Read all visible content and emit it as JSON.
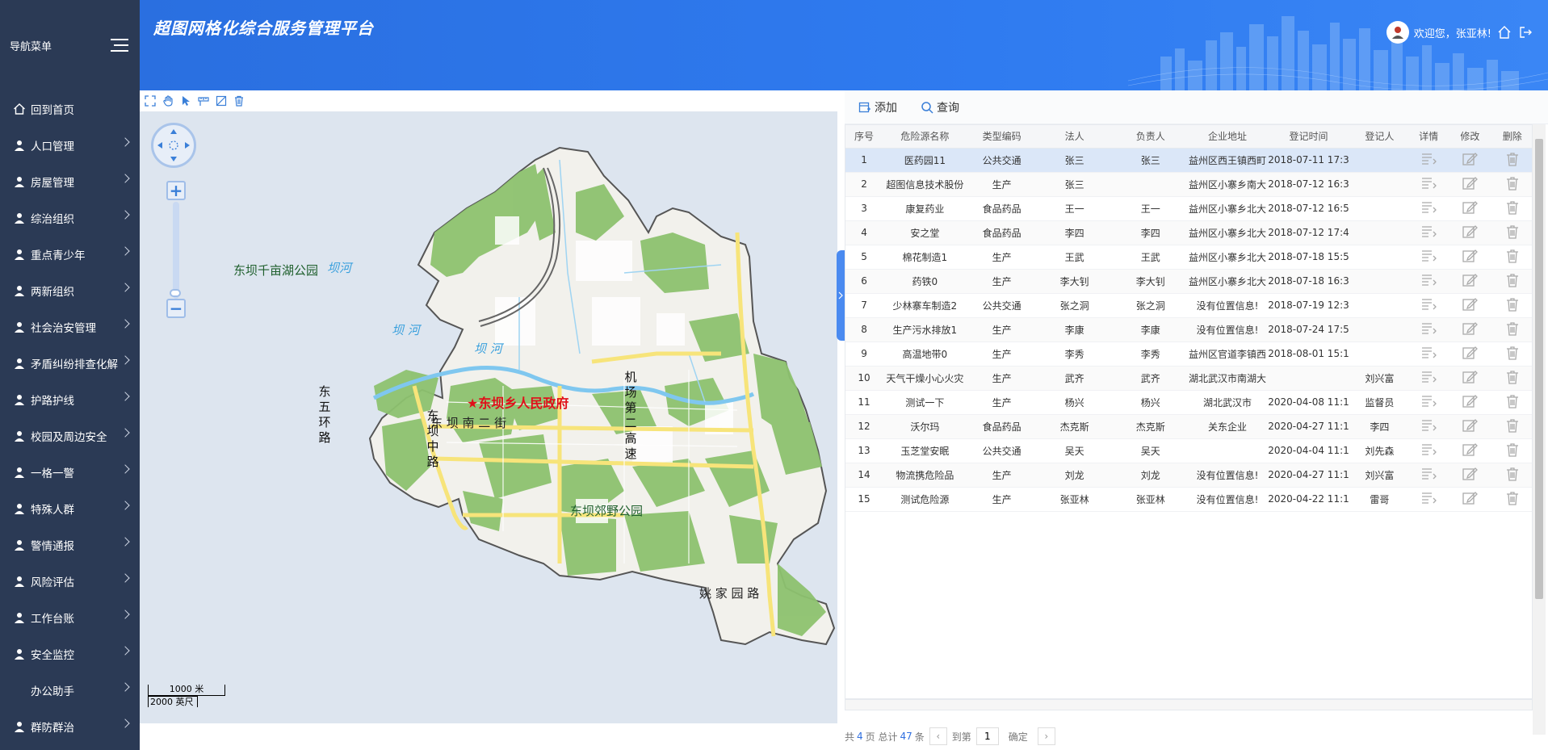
{
  "header": {
    "app_title": "超图网格化综合服务管理平台",
    "welcome": "欢迎您，张亚林!"
  },
  "sidebar": {
    "title": "导航菜单",
    "items": [
      {
        "label": "回到首页",
        "icon": "home-icon",
        "has_submenu": false
      },
      {
        "label": "人口管理",
        "icon": "person-gear-icon",
        "has_submenu": true
      },
      {
        "label": "房屋管理",
        "icon": "house-icon",
        "has_submenu": true
      },
      {
        "label": "综治组织",
        "icon": "org-icon",
        "has_submenu": true
      },
      {
        "label": "重点青少年",
        "icon": "rocking-horse-icon",
        "has_submenu": true
      },
      {
        "label": "两新组织",
        "icon": "group-icon",
        "has_submenu": true
      },
      {
        "label": "社会治安管理",
        "icon": "globe-icon",
        "has_submenu": true
      },
      {
        "label": "矛盾纠纷排查化解",
        "icon": "gavel-icon",
        "has_submenu": true
      },
      {
        "label": "护路护线",
        "icon": "road-icon",
        "has_submenu": true
      },
      {
        "label": "校园及周边安全",
        "icon": "shield-icon",
        "has_submenu": true
      },
      {
        "label": "一格一警",
        "icon": "police-icon",
        "has_submenu": true
      },
      {
        "label": "特殊人群",
        "icon": "people-icon",
        "has_submenu": true
      },
      {
        "label": "警情通报",
        "icon": "bell-person-icon",
        "has_submenu": true
      },
      {
        "label": "风险评估",
        "icon": "risk-icon",
        "has_submenu": true
      },
      {
        "label": "工作台账",
        "icon": "ledger-icon",
        "has_submenu": true
      },
      {
        "label": "安全监控",
        "icon": "camera-icon",
        "has_submenu": true
      },
      {
        "label": "办公助手",
        "icon": "",
        "has_submenu": true
      },
      {
        "label": "群防群治",
        "icon": "community-icon",
        "has_submenu": true
      }
    ]
  },
  "map": {
    "labels": {
      "park_north": "东坝千亩湖公园",
      "park_south": "东坝郊野公园",
      "gov": "★东坝乡人民政府",
      "river1": "坝河",
      "river2": "坝 河",
      "river3": "坝 河",
      "road_dongwuhuan": [
        "东",
        "五",
        "环",
        "路"
      ],
      "road_dongbazhong": [
        "东",
        "坝",
        "中",
        "路"
      ],
      "road_airport": [
        "机",
        "场",
        "第",
        "二",
        "高",
        "速"
      ],
      "road_nanerjie": "东 坝 南 二 街",
      "road_yaojiayuan": "姚 家 园 路"
    },
    "scale": {
      "metric": "1000 米",
      "imperial": "2000 英尺"
    }
  },
  "table_toolbar": {
    "add": "添加",
    "query": "查询"
  },
  "table": {
    "columns": [
      "序号",
      "危险源名称",
      "类型编码",
      "法人",
      "负责人",
      "企业地址",
      "登记时间",
      "登记人",
      "详情",
      "修改",
      "删除"
    ],
    "rows": [
      [
        "1",
        "医药园11",
        "公共交通",
        "张三",
        "张三",
        "益州区西王镇西町",
        "2018-07-11 17:3",
        ""
      ],
      [
        "2",
        "超图信息技术股份",
        "生产",
        "张三",
        "",
        "益州区小寨乡南大",
        "2018-07-12 16:3",
        ""
      ],
      [
        "3",
        "康复药业",
        "食品药品",
        "王一",
        "王一",
        "益州区小寨乡北大",
        "2018-07-12 16:5",
        ""
      ],
      [
        "4",
        "安之堂",
        "食品药品",
        "李四",
        "李四",
        "益州区小寨乡北大",
        "2018-07-12 17:4",
        ""
      ],
      [
        "5",
        "棉花制造1",
        "生产",
        "王武",
        "王武",
        "益州区小寨乡北大",
        "2018-07-18 15:5",
        ""
      ],
      [
        "6",
        "药铁0",
        "生产",
        "李大钊",
        "李大钊",
        "益州区小寨乡北大",
        "2018-07-18 16:3",
        ""
      ],
      [
        "7",
        "少林寨车制造2",
        "公共交通",
        "张之洞",
        "张之洞",
        "没有位置信息!",
        "2018-07-19 12:3",
        ""
      ],
      [
        "8",
        "生产污水排放1",
        "生产",
        "李康",
        "李康",
        "没有位置信息!",
        "2018-07-24 17:5",
        ""
      ],
      [
        "9",
        "高温地带0",
        "生产",
        "李秀",
        "李秀",
        "益州区官道李镇西",
        "2018-08-01 15:1",
        ""
      ],
      [
        "10",
        "天气干燥小心火灾",
        "生产",
        "武齐",
        "武齐",
        "湖北武汉市南湖大",
        "",
        "刘兴富"
      ],
      [
        "11",
        "测试一下",
        "生产",
        "杨兴",
        "杨兴",
        "湖北武汉市",
        "2020-04-08 11:1",
        "监督员"
      ],
      [
        "12",
        "沃尔玛",
        "食品药品",
        "杰克斯",
        "杰克斯",
        "关东企业",
        "2020-04-27 11:1",
        "李四"
      ],
      [
        "13",
        "玉芝堂安眠",
        "公共交通",
        "吴天",
        "吴天",
        "",
        "2020-04-04 11:1",
        "刘先森"
      ],
      [
        "14",
        "物流携危险品",
        "生产",
        "刘龙",
        "刘龙",
        "没有位置信息!",
        "2020-04-27 11:1",
        "刘兴富"
      ],
      [
        "15",
        "测试危险源",
        "生产",
        "张亚林",
        "张亚林",
        "没有位置信息!",
        "2020-04-22 11:1",
        "雷哥"
      ]
    ]
  },
  "pager": {
    "prefix": "共",
    "pages": "4",
    "mid": "页 总计",
    "total": "47",
    "suffix": "条",
    "goto": "到第",
    "page_value": "1",
    "confirm": "确定"
  },
  "colors": {
    "sidebar": "#2b3a55",
    "header": "#2f7bf0",
    "selected_row": "#dbe7f8",
    "gov_label": "#e0101a",
    "park_green": "#8dc26f"
  }
}
